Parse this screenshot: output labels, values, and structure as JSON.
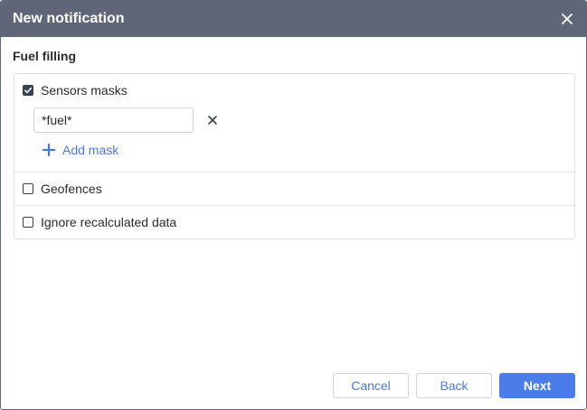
{
  "dialog": {
    "title": "New notification",
    "close_icon": "close-icon"
  },
  "section": {
    "title": "Fuel filling"
  },
  "options": {
    "sensors_masks": {
      "label": "Sensors masks",
      "checked": true
    },
    "mask_value": "*fuel*",
    "remove_mask_icon": "close-icon",
    "add_mask_label": "Add mask",
    "add_mask_icon": "plus-icon",
    "geofences": {
      "label": "Geofences",
      "checked": false
    },
    "ignore_recalculated": {
      "label": "Ignore recalculated data",
      "checked": false
    }
  },
  "footer": {
    "cancel_label": "Cancel",
    "back_label": "Back",
    "next_label": "Next"
  },
  "colors": {
    "titlebar": "#5f6677",
    "accent": "#4a7de8",
    "link": "#4a78e3"
  }
}
